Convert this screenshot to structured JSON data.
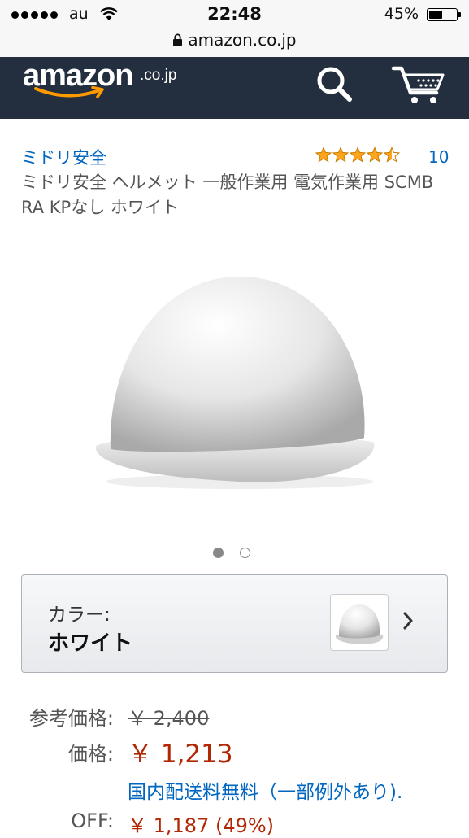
{
  "status_bar": {
    "carrier": "au",
    "time": "22:48",
    "battery": "45%",
    "battery_level": 0.45,
    "icons": [
      "signal-dots",
      "wifi-icon",
      "battery-icon"
    ]
  },
  "url_bar": {
    "url": "amazon.co.jp",
    "icon": "lock-icon"
  },
  "header": {
    "logo_text": "amazon",
    "logo_suffix": ".co.jp",
    "icons": [
      "search-icon",
      "cart-icon"
    ],
    "colors": {
      "background": "#232f3e",
      "smile": "#ff9900"
    }
  },
  "product": {
    "brand": "ミドリ安全",
    "rating": 4.5,
    "rating_max": 5,
    "rating_count": "10",
    "title": "ミドリ安全 ヘルメット 一般作業用 電気作業用 SCMB RA KPなし ホワイト",
    "image_dots": {
      "count": 2,
      "active": 1
    }
  },
  "color_selector": {
    "label": "カラー:",
    "value": "ホワイト"
  },
  "price": {
    "list_label": "参考価格:",
    "list_price": "￥ 2,400",
    "price_label": "価格:",
    "price": "￥ 1,213",
    "shipping": "国内配送料無料（一部例外あり).",
    "off_label": "OFF:",
    "savings": "￥ 1,187 (49%)"
  },
  "colors": {
    "link": "#0066c0",
    "price": "#b12704",
    "star": "#ffa41c"
  }
}
